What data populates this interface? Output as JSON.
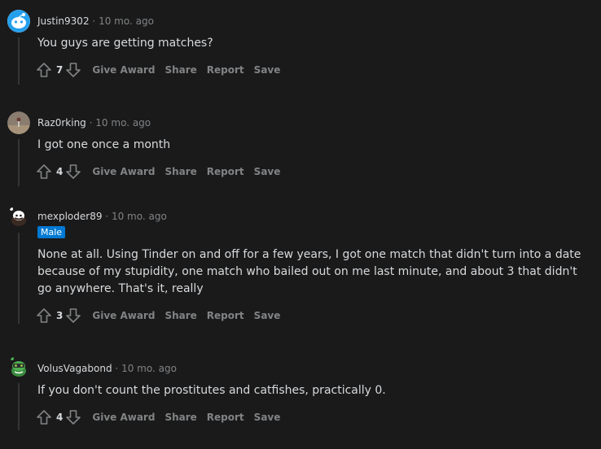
{
  "colors": {
    "background": "#1a1a1b",
    "text": "#d7dadc",
    "muted": "#818384",
    "flair": "#0079d3"
  },
  "actions": {
    "give_award": "Give Award",
    "share": "Share",
    "report": "Report",
    "save": "Save"
  },
  "separator": "·",
  "comments": [
    {
      "author": "Justin9302",
      "time": "10 mo. ago",
      "body": "You guys are getting matches?",
      "score": "7",
      "avatar_icon": "snoo-avatar-icon"
    },
    {
      "author": "Raz0rking",
      "time": "10 mo. ago",
      "body": "I got one once a month",
      "score": "4",
      "avatar_icon": "photo-avatar-icon"
    },
    {
      "author": "mexploder89",
      "time": "10 mo. ago",
      "flair": "Male",
      "body": "None at all. Using Tinder on and off for a few years, I got one match that didn't turn into a date because of my stupidity, one match who bailed out on me last minute, and about 3 that didn't go anywhere. That's it, really",
      "score": "3",
      "avatar_icon": "snoo-avatar-icon"
    },
    {
      "author": "VolusVagabond",
      "time": "10 mo. ago",
      "body": "If you don't count the prostitutes and catfishes, practically 0.",
      "score": "4",
      "avatar_icon": "snoo-avatar-icon"
    }
  ]
}
